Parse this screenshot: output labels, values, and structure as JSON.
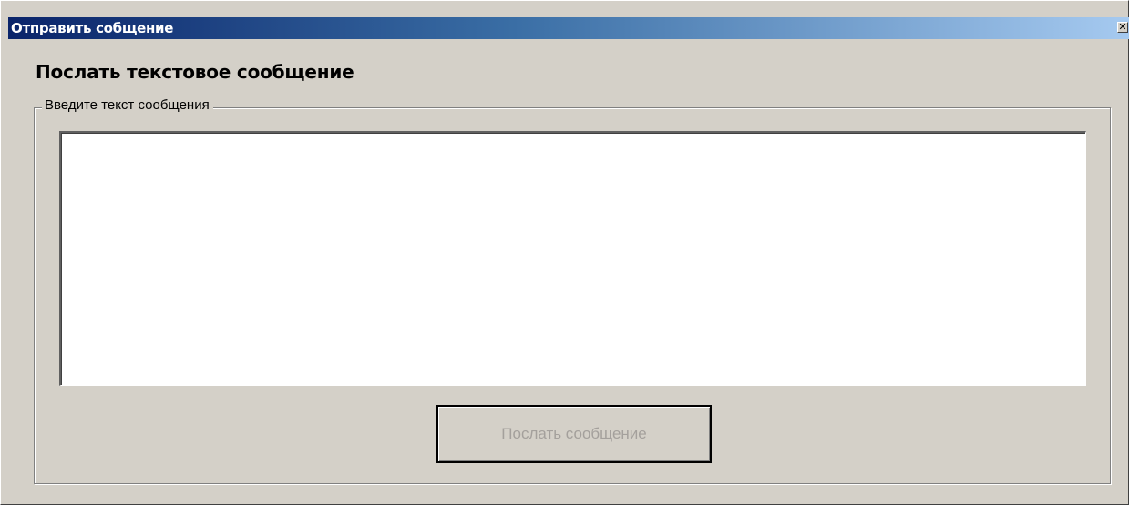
{
  "window": {
    "title": "Отправить собщение",
    "close_glyph": "✕",
    "close_icon": "close-icon"
  },
  "heading": "Послать текстовое сообщение",
  "group": {
    "label": "Введите текст сообщения"
  },
  "message": {
    "value": "",
    "placeholder": ""
  },
  "send_button": {
    "label": "Послать сообщение",
    "enabled": false
  },
  "colors": {
    "title_gradient_start": "#0a246a",
    "title_gradient_end": "#a6caf0",
    "window_face": "#d4d0c8",
    "disabled_text": "#a4a09c"
  }
}
